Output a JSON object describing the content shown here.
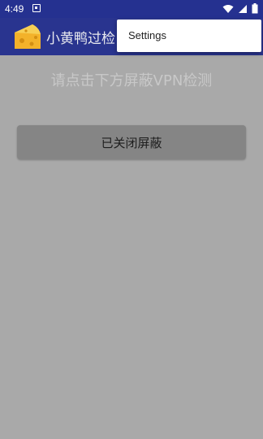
{
  "status_bar": {
    "time": "4:49",
    "icons": [
      "notification-icon",
      "wifi-icon",
      "signal-icon",
      "battery-icon"
    ],
    "background": "#253190"
  },
  "app_bar": {
    "title": "小黄鸭过检",
    "logo": "cheese-duck-logo",
    "background": "#29348f"
  },
  "main": {
    "hint": "请点击下方屏蔽VPN检测",
    "toggle_button_label": "已关闭屏蔽",
    "scrim_color": "#a9a9a9"
  },
  "overflow_menu": {
    "items": [
      {
        "label": "Settings"
      }
    ]
  }
}
